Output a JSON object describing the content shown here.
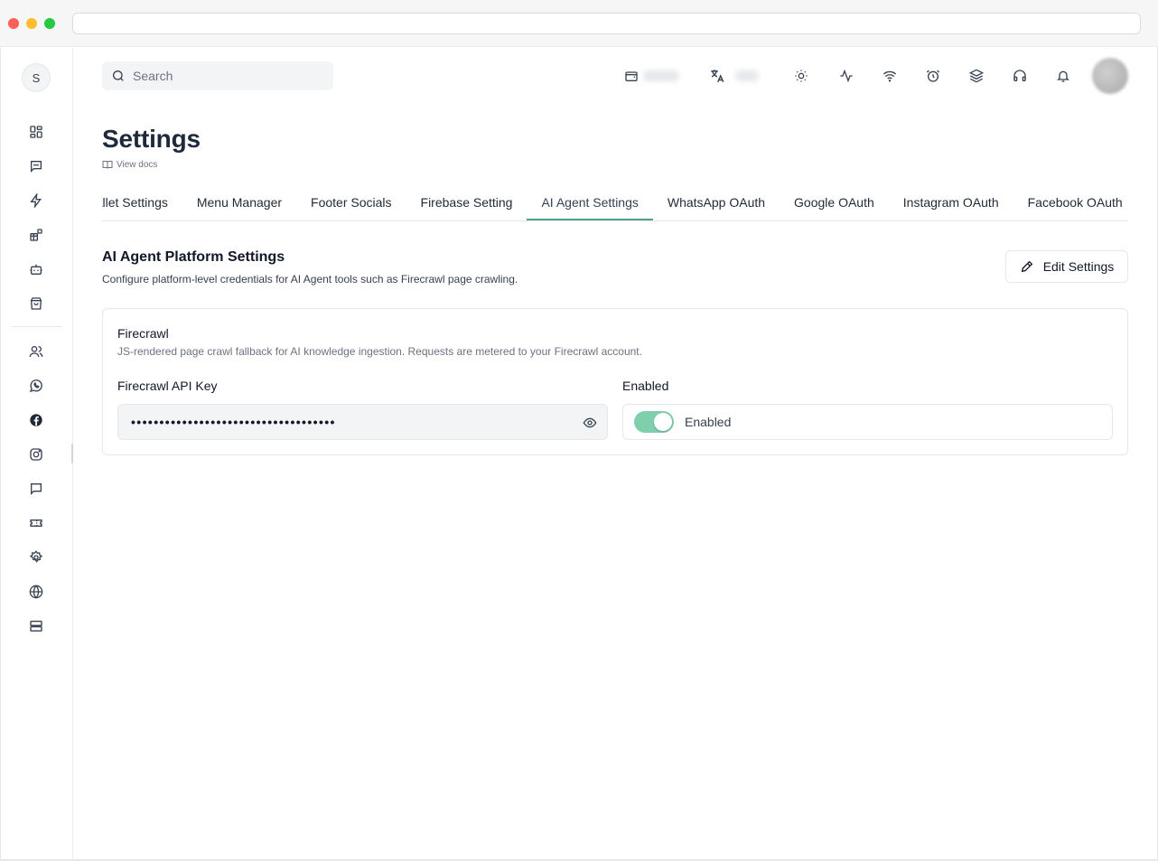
{
  "sidebar": {
    "avatar_initial": "S",
    "icons": [
      "dashboard-icon",
      "chat-icon",
      "lightning-icon",
      "apps-icon",
      "bot-icon",
      "shopping-bag-icon",
      "users-icon",
      "whatsapp-icon",
      "facebook-icon",
      "instagram-icon",
      "message-icon",
      "ticket-icon",
      "settings-icon",
      "globe-icon",
      "server-icon"
    ]
  },
  "header": {
    "search_placeholder": "Search",
    "icons": [
      "wallet-icon",
      "translate-icon",
      "sun-icon",
      "activity-icon",
      "wifi-icon",
      "alarm-icon",
      "layers-icon",
      "headset-icon",
      "bell-icon"
    ]
  },
  "page": {
    "title": "Settings",
    "docs_link": "View docs"
  },
  "tabs": [
    {
      "label": "Wallet Settings"
    },
    {
      "label": "Menu Manager"
    },
    {
      "label": "Footer Socials"
    },
    {
      "label": "Firebase Setting"
    },
    {
      "label": "AI Agent Settings",
      "active": true
    },
    {
      "label": "WhatsApp OAuth"
    },
    {
      "label": "Google OAuth"
    },
    {
      "label": "Instagram OAuth"
    },
    {
      "label": "Facebook OAuth"
    }
  ],
  "section": {
    "title": "AI Agent Platform Settings",
    "description": "Configure platform-level credentials for AI Agent tools such as Firecrawl page crawling.",
    "edit_button": "Edit Settings"
  },
  "firecrawl": {
    "title": "Firecrawl",
    "description": "JS-rendered page crawl fallback for AI knowledge ingestion. Requests are metered to your Firecrawl account.",
    "api_key_label": "Firecrawl API Key",
    "api_key_value": "••••••••••••••••••••••••••••••••••••",
    "enabled_label": "Enabled",
    "enabled_state_text": "Enabled",
    "enabled": true
  },
  "colors": {
    "accent": "#4f9f8b",
    "toggle_on": "#7fcfad"
  }
}
